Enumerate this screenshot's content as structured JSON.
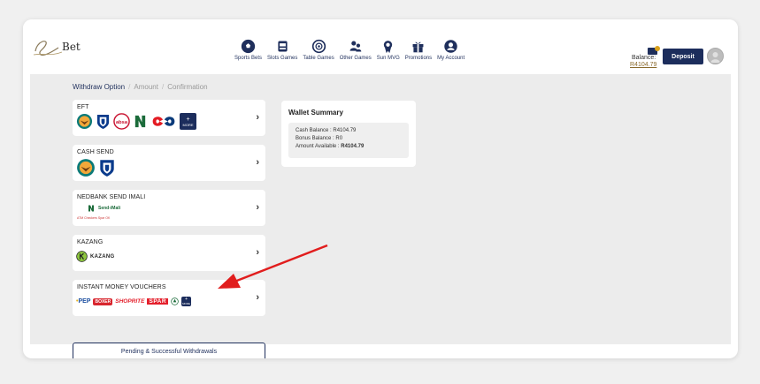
{
  "header": {
    "logo_text": "Bet",
    "nav": [
      {
        "label": "Sports Bets",
        "icon": "soccer-ball-icon"
      },
      {
        "label": "Slots Games",
        "icon": "slot-machine-icon"
      },
      {
        "label": "Table Games",
        "icon": "roulette-icon"
      },
      {
        "label": "Other Games",
        "icon": "people-icon"
      },
      {
        "label": "Sun MVG",
        "icon": "award-ribbon-icon"
      },
      {
        "label": "Promotions",
        "icon": "gift-icon"
      },
      {
        "label": "My Account",
        "icon": "user-icon"
      }
    ],
    "balance_label": "Balance:",
    "balance_value": "R4104.79",
    "deposit_label": "Deposit"
  },
  "breadcrumb": {
    "step1": "Withdraw Option",
    "step2": "Amount",
    "step3": "Confirmation",
    "separator": "/"
  },
  "options": [
    {
      "title": "EFT"
    },
    {
      "title": "CASH SEND"
    },
    {
      "title": "NEDBANK SEND IMALI"
    },
    {
      "title": "KAZANG"
    },
    {
      "title": "INSTANT MONEY VOUCHERS"
    }
  ],
  "logos": {
    "more": "MORE",
    "absa": "absa",
    "send_imali": "Send-iMali",
    "send_imali_partners": "ATM Checkers Spar OK",
    "kazang": "KAZANG",
    "pep": "PEP",
    "boxer": "BOXER",
    "shoprite": "SHOPRITE",
    "spar": "SPAR"
  },
  "pending_button": "Pending & Successful Withdrawals",
  "wallet": {
    "title": "Wallet Summary",
    "cash_balance": "Cash Balance : R4104.79",
    "bonus_balance": "Bonus Balance : R0",
    "amount_available_label": "Amount Available : ",
    "amount_available_value": "R4104.79"
  },
  "colors": {
    "navy": "#1c2d5c",
    "gold": "#8a6a2c",
    "arrow": "#e11d1d",
    "card_bg": "#ffffff",
    "content_bg": "#ececec"
  }
}
